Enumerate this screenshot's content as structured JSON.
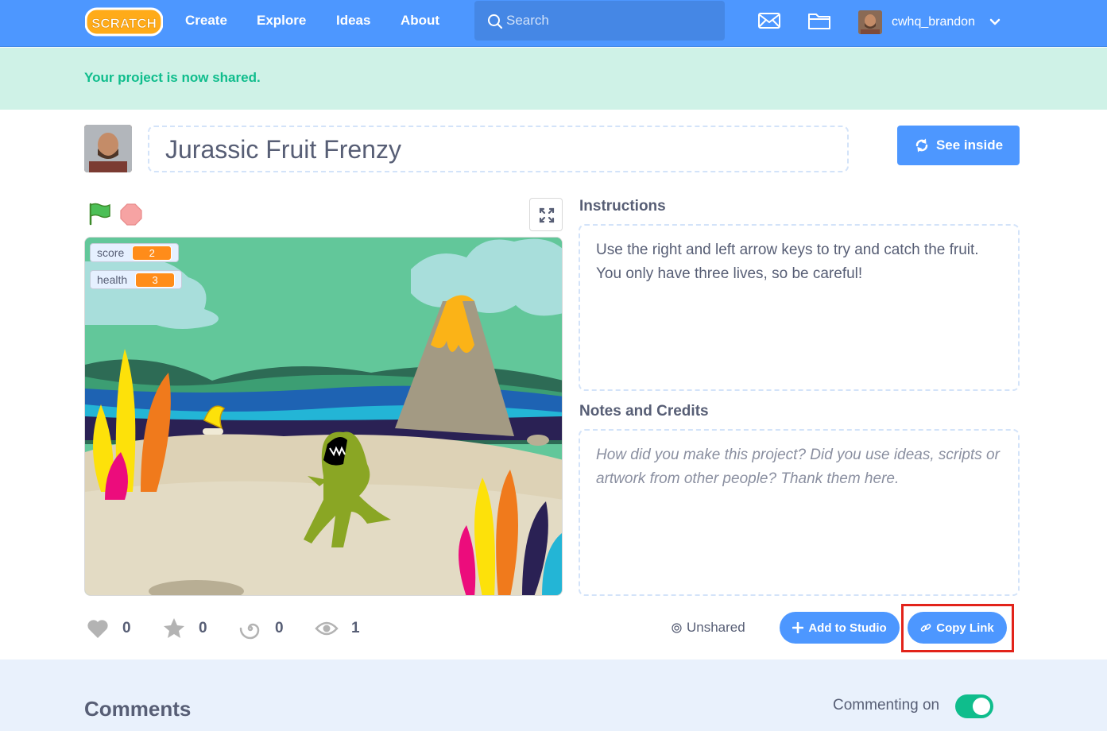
{
  "nav": {
    "logo_text": "SCRATCH",
    "links": [
      "Create",
      "Explore",
      "Ideas",
      "About"
    ],
    "search_placeholder": "Search",
    "username": "cwhq_brandon"
  },
  "banner": {
    "message": "Your project is now shared."
  },
  "project": {
    "title": "Jurassic Fruit Frenzy",
    "see_inside_label": "See inside"
  },
  "stage": {
    "monitors": [
      {
        "label": "score",
        "value": "2"
      },
      {
        "label": "health",
        "value": "3"
      }
    ]
  },
  "instructions": {
    "label": "Instructions",
    "text": "Use the right and left arrow keys to try and catch the fruit. You only have three lives, so be careful!"
  },
  "notes": {
    "label": "Notes and Credits",
    "placeholder": "How did you make this project? Did you use ideas, scripts or artwork from other people? Thank them here."
  },
  "stats": {
    "loves": "0",
    "favorites": "0",
    "remixes": "0",
    "views": "1"
  },
  "actions": {
    "unshared_label": "Unshared",
    "add_to_studio_label": "Add to Studio",
    "copy_link_label": "Copy Link"
  },
  "comments": {
    "title": "Comments",
    "commenting_label": "Commenting on",
    "commenting_on": true
  },
  "colors": {
    "brand_blue": "#4d97ff",
    "banner_bg": "#cff2e7",
    "banner_text": "#0fbd8c",
    "monitor_orange": "#ff8c1a",
    "highlight_red": "#e2231a"
  }
}
